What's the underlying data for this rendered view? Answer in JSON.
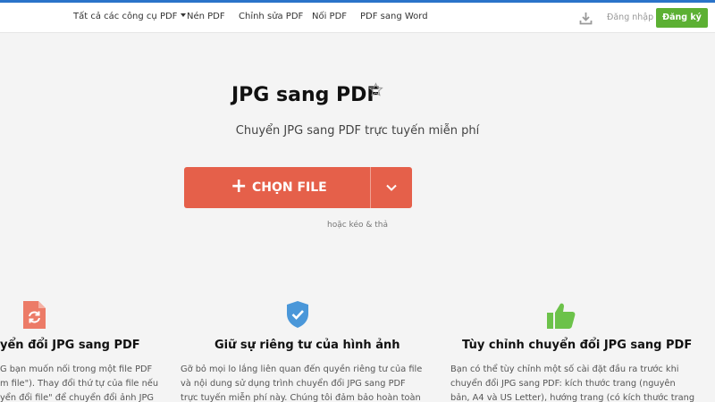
{
  "nav": {
    "all_tools": "Tất cả các công cụ PDF",
    "compress": "Nén PDF",
    "edit": "Chỉnh sửa PDF",
    "merge": "Nối PDF",
    "pdf_to_word": "PDF sang Word",
    "login": "Đăng nhập",
    "signup": "Đăng ký"
  },
  "hero": {
    "title": "JPG sang PDF",
    "subtitle": "Chuyển JPG sang PDF trực tuyến miễn phí",
    "choose_file": "CHỌN FILE",
    "drag_hint": "hoặc kéo & thả"
  },
  "features": [
    {
      "icon": "refresh-file-icon",
      "title": "yển đổi JPG sang PDF",
      "lines": [
        "G bạn muốn nối trong một file PDF",
        "m file\"). Thay đổi thứ tự của file nếu",
        "yển đổi file\" để chuyển đổi ảnh JPG"
      ]
    },
    {
      "icon": "shield-check-icon",
      "title": "Giữ sự riêng tư của hình ảnh",
      "lines": [
        "Gỡ bỏ mọi lo lắng liên quan đến quyền riêng tư của file",
        "và nội dung sử dụng trình chuyển đổi JPG sang PDF",
        "trực tuyến miễn phí này. Chúng tôi đảm bảo hoàn toàn"
      ]
    },
    {
      "icon": "thumbs-up-icon",
      "title": "Tùy chỉnh chuyển đổi JPG sang PDF",
      "lines": [
        "Bạn có thể tùy chỉnh một số cài đặt đầu ra trước khi",
        "chuyển đổi JPG sang PDF: kích thước trang (nguyên",
        "bản, A4 và US Letter), hướng trang (có kích thước trang"
      ]
    }
  ],
  "colors": {
    "accent": "#e5604a",
    "signup": "#5cb033",
    "feature_1": "#ec7b67",
    "feature_2": "#4a97d9",
    "feature_3": "#6cc24a"
  }
}
